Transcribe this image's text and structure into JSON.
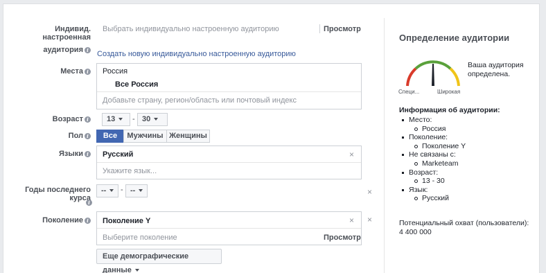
{
  "custom_audience": {
    "label_line1": "Индивид. настроенная",
    "label_line2": "аудитория",
    "placeholder": "Выбрать индивидуально настроенную аудиторию",
    "browse": "Просмотр",
    "create_link": "Создать новую индивидуально настроенную аудиторию"
  },
  "locations": {
    "label": "Места",
    "country": "Россия",
    "selected": "Все Россия",
    "placeholder": "Добавьте страну, регион/область или почтовый индекс"
  },
  "age": {
    "label": "Возраст",
    "min": "13",
    "separator": "-",
    "max": "30"
  },
  "gender": {
    "label": "Пол",
    "options": [
      "Все",
      "Мужчины",
      "Женщины"
    ],
    "selected": "Все"
  },
  "languages": {
    "label": "Языки",
    "selected": "Русский",
    "placeholder": "Укажите язык..."
  },
  "grad_years": {
    "label": "Годы последнего курса",
    "from": "--",
    "separator": "-",
    "to": "--"
  },
  "generation": {
    "label": "Поколение",
    "selected": "Поколение Y",
    "placeholder": "Выберите поколение",
    "browse": "Просмотр"
  },
  "more_demo": {
    "label": "Еще демографические данные"
  },
  "audience_definition": {
    "title": "Определение аудитории",
    "gauge_left": "Специ...",
    "gauge_right": "Широкая",
    "status": "Ваша аудитория определена.",
    "details_title": "Информация об аудитории:",
    "items": [
      {
        "label": "Место:",
        "values": [
          "Россия"
        ]
      },
      {
        "label": "Поколение:",
        "values": [
          "Поколение Y"
        ]
      },
      {
        "label": "Не связаны с:",
        "values": [
          "Marketeam"
        ]
      },
      {
        "label": "Возраст:",
        "values": [
          "13 - 30"
        ]
      },
      {
        "label": "Язык:",
        "values": [
          "Русский"
        ]
      }
    ],
    "reach_label": "Потенциальный охват (пользователи):",
    "reach_value": "4 400 000",
    "colors": {
      "gauge_red": "#d93b2b",
      "gauge_yellow": "#f0c419",
      "gauge_green": "#5aa13b",
      "accent": "#4267b2"
    }
  },
  "icons": {
    "info": "info-icon",
    "close": "close-icon",
    "caret": "caret-down-icon"
  }
}
